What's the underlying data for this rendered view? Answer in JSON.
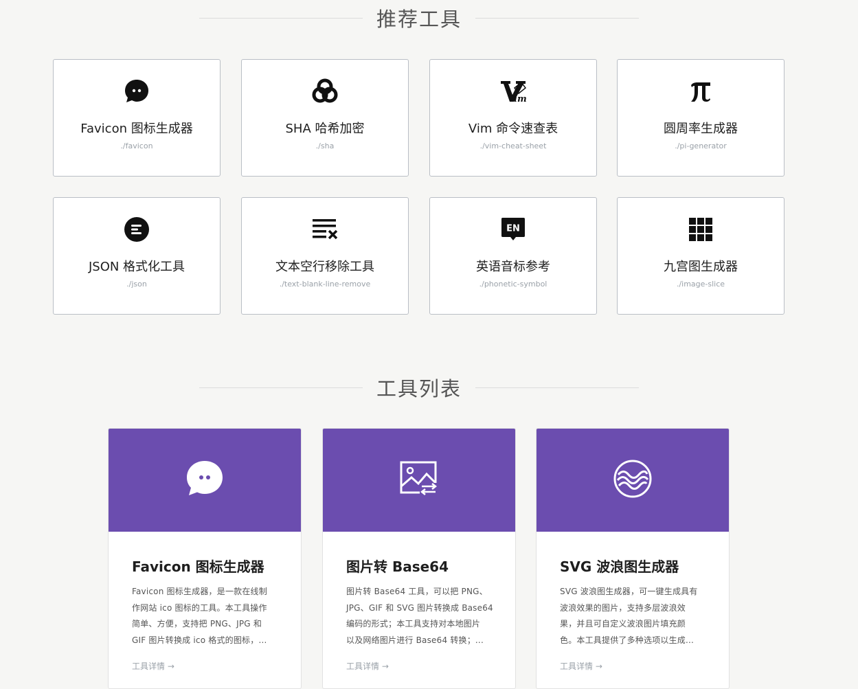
{
  "recommended": {
    "heading": "推荐工具",
    "cards": [
      {
        "title": "Favicon 图标生成器",
        "path": "./favicon",
        "icon": "chat-bubble-icon"
      },
      {
        "title": "SHA 哈希加密",
        "path": "./sha",
        "icon": "sha-swirl-icon"
      },
      {
        "title": "Vim 命令速查表",
        "path": "./vim-cheat-sheet",
        "icon": "vim-logo-icon"
      },
      {
        "title": "圆周率生成器",
        "path": "./pi-generator",
        "icon": "pi-icon"
      },
      {
        "title": "JSON 格式化工具",
        "path": "./json",
        "icon": "format-lines-icon"
      },
      {
        "title": "文本空行移除工具",
        "path": "./text-blank-line-remove",
        "icon": "text-remove-icon"
      },
      {
        "title": "英语音标参考",
        "path": "./phonetic-symbol",
        "icon": "en-badge-icon"
      },
      {
        "title": "九宫图生成器",
        "path": "./image-slice",
        "icon": "grid-icon"
      }
    ]
  },
  "tool_list": {
    "heading": "工具列表",
    "banner_color": "#6b4daf",
    "cards": [
      {
        "title": "Favicon 图标生成器",
        "desc_lines": [
          "Favicon 图标生成器，是一款在线制",
          "作网站 ico 图标的工具。本工具操作",
          "简单、方便，支持把 PNG、JPG 和",
          "GIF 图片转换成 ico 格式的图标，..."
        ],
        "link": "工具详情 →",
        "icon": "chat-bubble-icon"
      },
      {
        "title": "图片转 Base64",
        "desc_lines": [
          "图片转 Base64 工具，可以把 PNG、",
          "JPG、GIF 和 SVG 图片转换成 Base64",
          "编码的形式；本工具支持对本地图片",
          "以及网络图片进行 Base64 转换；..."
        ],
        "link": "工具详情 →",
        "icon": "image-convert-icon"
      },
      {
        "title": "SVG 波浪图生成器",
        "desc_lines": [
          "SVG 波浪图生成器，可一键生成具有",
          "波浪效果的图片，支持多层波浪效",
          "果，并且可自定义波浪图片填充颜",
          "色。本工具提供了多种选项以生成..."
        ],
        "link": "工具详情 →",
        "icon": "wave-circle-icon"
      }
    ]
  }
}
